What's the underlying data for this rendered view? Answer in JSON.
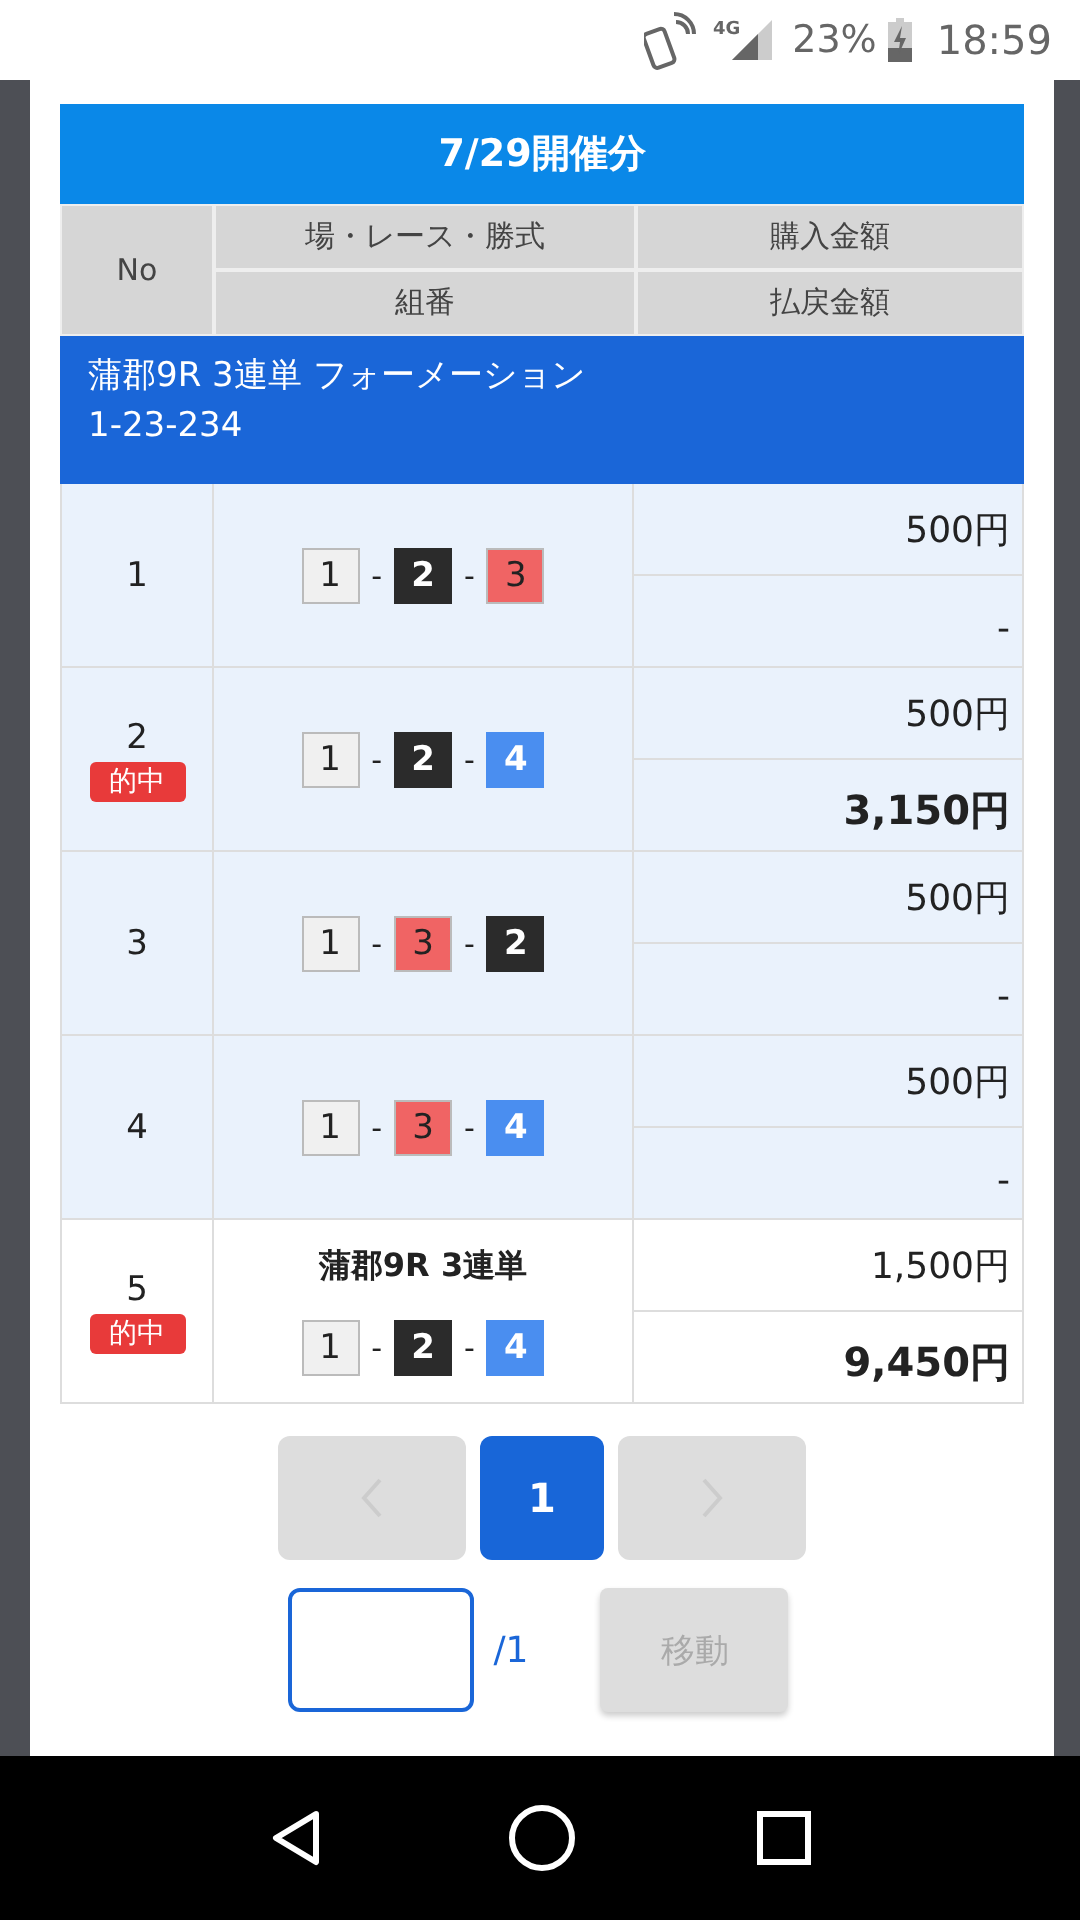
{
  "status_bar": {
    "network": "4G",
    "battery": "23%",
    "time": "18:59"
  },
  "title": "7/29開催分",
  "header": {
    "no": "No",
    "race": "場・レース・勝式",
    "combo": "組番",
    "purchase": "購入金額",
    "payout": "払戻金額"
  },
  "group": {
    "line_1": "蒲郡9R 3連単 フォーメーション",
    "line_2": "1-23-234"
  },
  "rows": [
    {
      "no": "1",
      "hit": false,
      "combo": [
        {
          "kind": "boat",
          "num": "1",
          "color": "#f0f0f0"
        },
        {
          "kind": "dash",
          "text": "-"
        },
        {
          "kind": "boat",
          "num": "2",
          "color": "#2b2b2b"
        },
        {
          "kind": "dash",
          "text": "-"
        },
        {
          "kind": "boat",
          "num": "3",
          "color": "#f06464"
        }
      ],
      "purchase": "500円",
      "payout": "-"
    },
    {
      "no": "2",
      "hit": true,
      "badge": "的中",
      "combo": [
        {
          "kind": "boat",
          "num": "1",
          "color": "#f0f0f0"
        },
        {
          "kind": "dash",
          "text": "-"
        },
        {
          "kind": "boat",
          "num": "2",
          "color": "#2b2b2b"
        },
        {
          "kind": "dash",
          "text": "-"
        },
        {
          "kind": "boat",
          "num": "4",
          "color": "#4a8ef0"
        }
      ],
      "purchase": "500円",
      "payout": "3,150円"
    },
    {
      "no": "3",
      "hit": false,
      "combo": [
        {
          "kind": "boat",
          "num": "1",
          "color": "#f0f0f0"
        },
        {
          "kind": "dash",
          "text": "-"
        },
        {
          "kind": "boat",
          "num": "3",
          "color": "#f06464"
        },
        {
          "kind": "dash",
          "text": "-"
        },
        {
          "kind": "boat",
          "num": "2",
          "color": "#2b2b2b"
        }
      ],
      "purchase": "500円",
      "payout": "-"
    },
    {
      "no": "4",
      "hit": false,
      "combo": [
        {
          "kind": "boat",
          "num": "1",
          "color": "#f0f0f0"
        },
        {
          "kind": "dash",
          "text": "-"
        },
        {
          "kind": "boat",
          "num": "3",
          "color": "#f06464"
        },
        {
          "kind": "dash",
          "text": "-"
        },
        {
          "kind": "boat",
          "num": "4",
          "color": "#4a8ef0"
        }
      ],
      "purchase": "500円",
      "payout": "-"
    },
    {
      "no": "5",
      "hit": true,
      "badge": "的中",
      "race": "蒲郡9R 3連単",
      "combo": [
        {
          "kind": "boat",
          "num": "1",
          "color": "#f0f0f0"
        },
        {
          "kind": "dash",
          "text": "-"
        },
        {
          "kind": "boat",
          "num": "2",
          "color": "#2b2b2b"
        },
        {
          "kind": "dash",
          "text": "-"
        },
        {
          "kind": "boat",
          "num": "4",
          "color": "#4a8ef0"
        }
      ],
      "purchase": "1,500円",
      "payout": "9,450円"
    }
  ],
  "pagination": {
    "pages": [
      {
        "label": "1",
        "selected": true
      }
    ],
    "total": "/1",
    "move_button": {
      "label": "移動",
      "disabled": true
    }
  }
}
